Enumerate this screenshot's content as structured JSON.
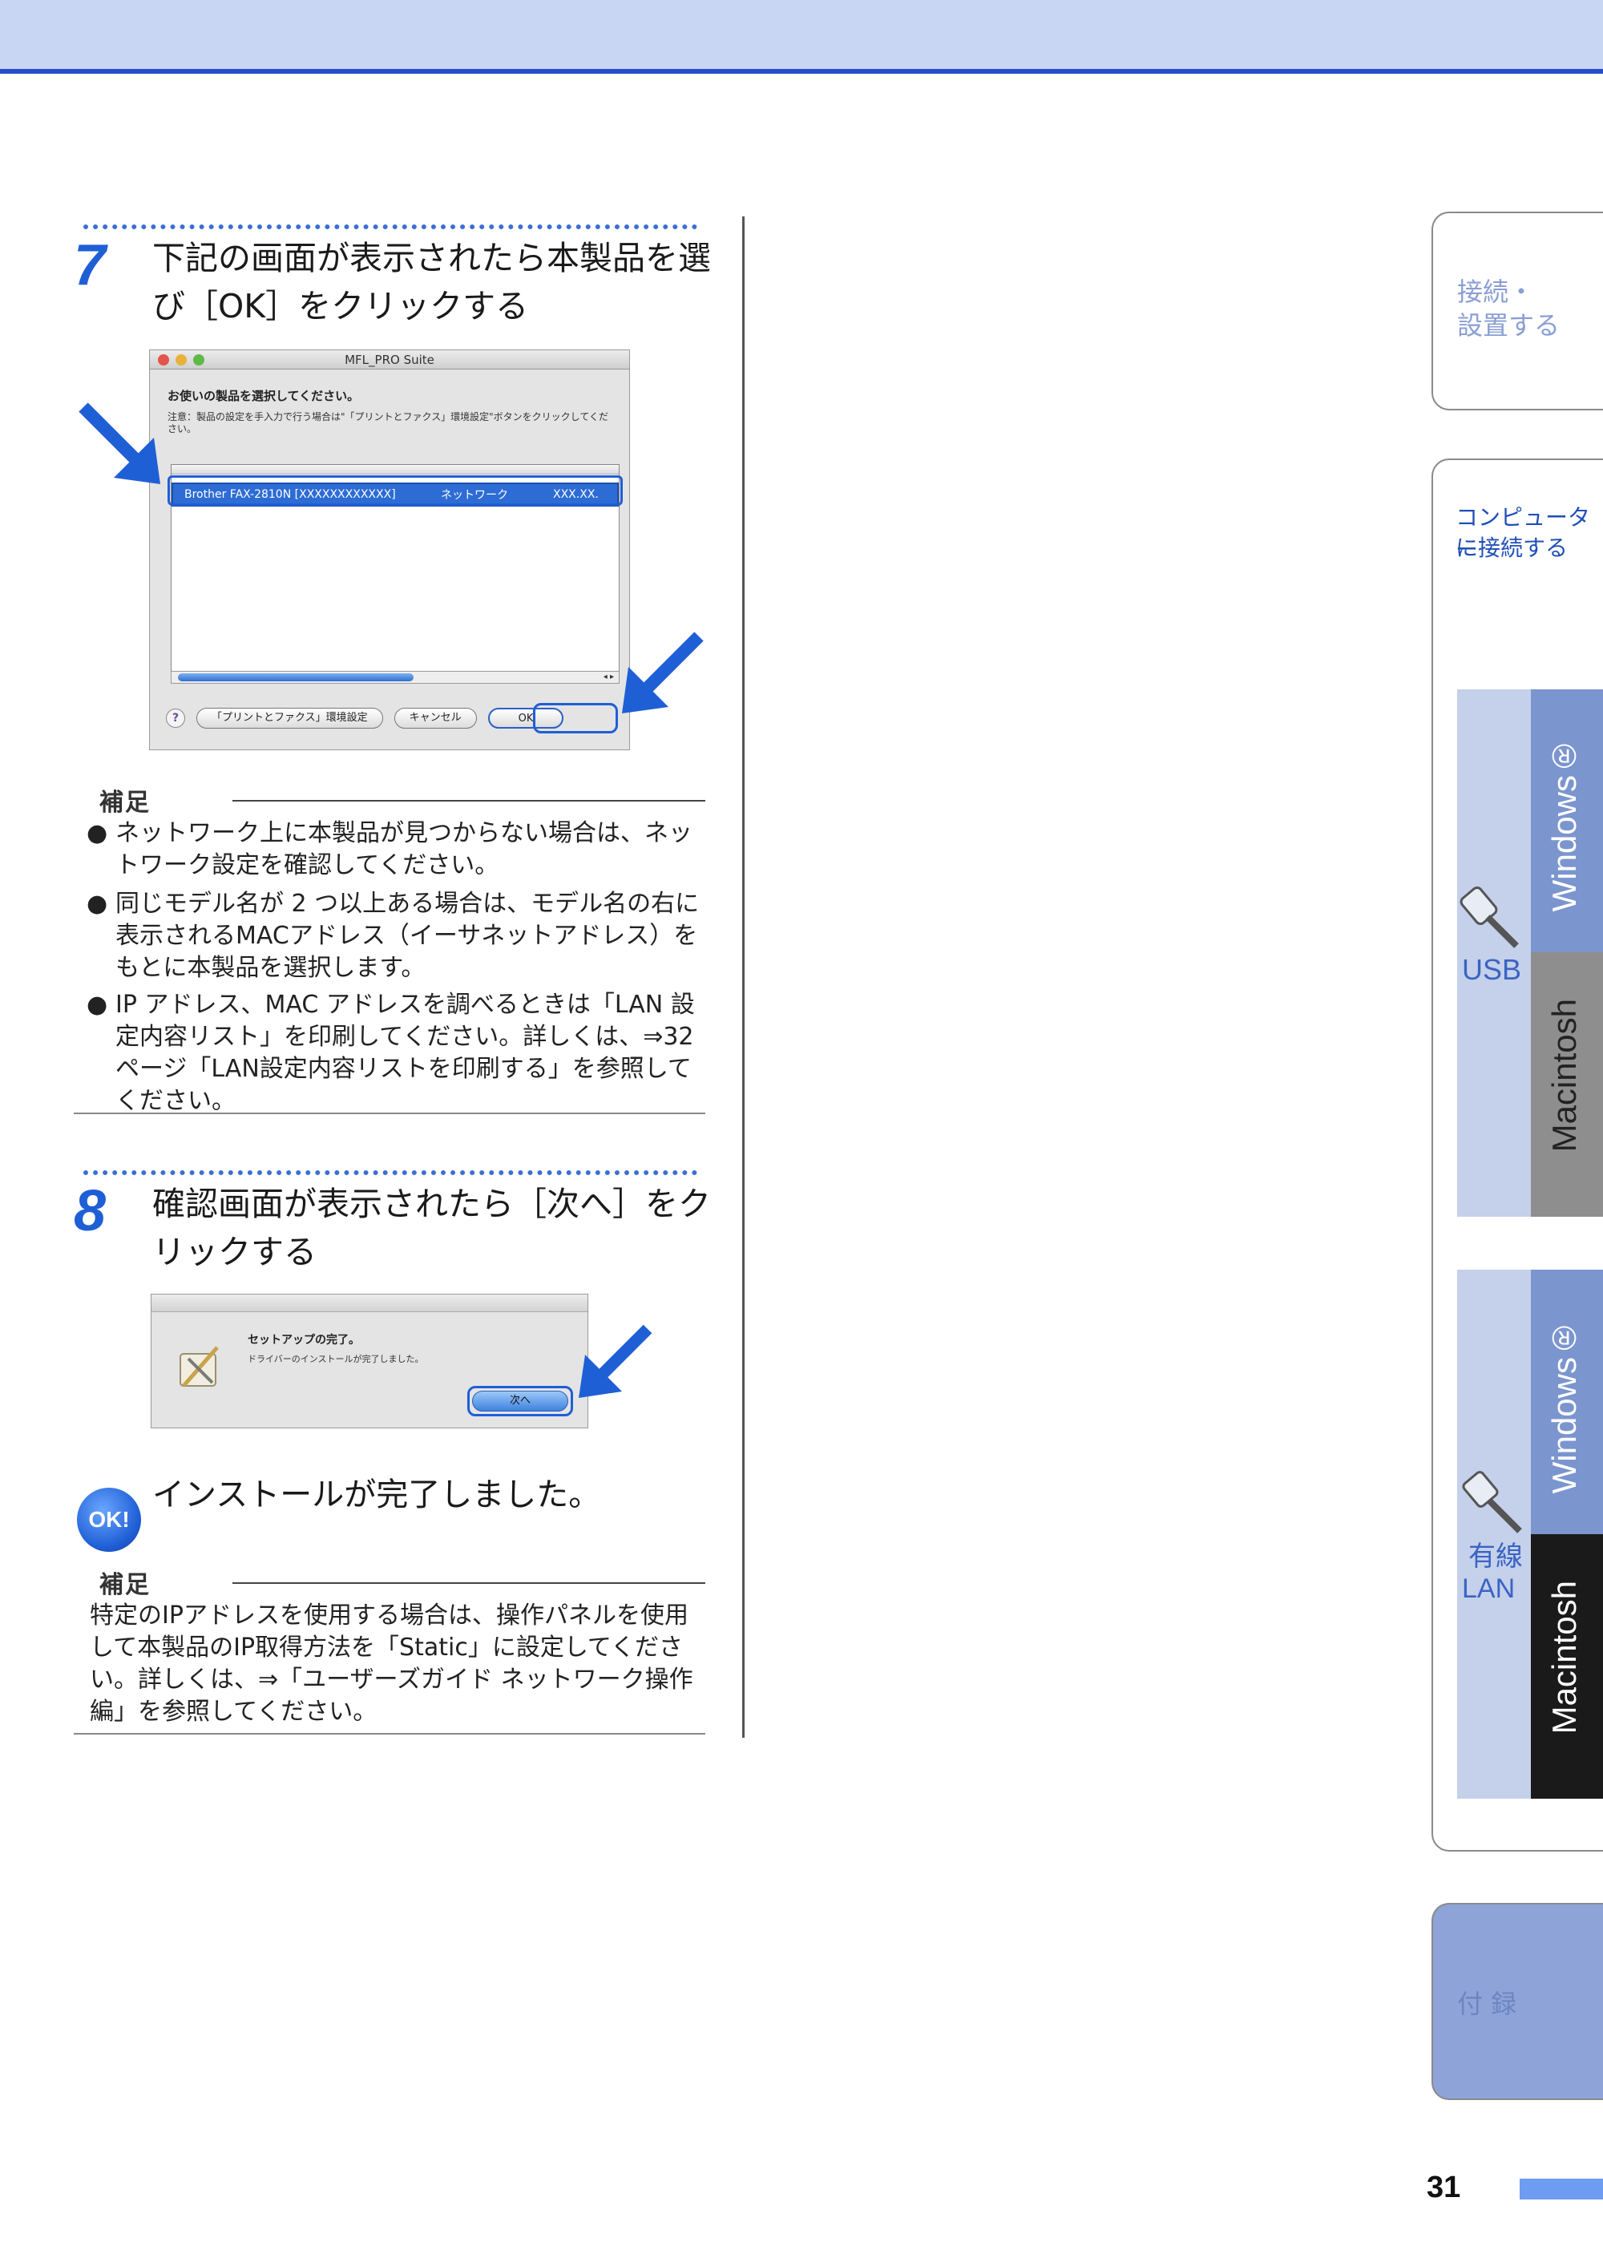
{
  "step7": {
    "number": "7",
    "title_line1": "下記の画面が表示されたら本製品を選",
    "title_line2": "び［OK］をクリックする",
    "dialog": {
      "window_title": "MFL_PRO Suite",
      "heading": "お使いの製品を選択してください。",
      "note": "注意：製品の設定を手入力で行う場合は\"「プリントとファクス」環境設定\"ボタンをクリックしてください。",
      "row": {
        "name": "Brother FAX-2810N [XXXXXXXXXXXX]",
        "type": "ネットワーク",
        "address": "XXX.XX."
      },
      "help_label": "?",
      "print_fax_button": "「プリントとファクス」環境設定",
      "cancel_button": "キャンセル",
      "ok_button": "OK",
      "scroll_buttons": "◂ ▸"
    }
  },
  "hosoku1": {
    "tag": "補足",
    "bullet_mark": "●",
    "items": [
      "ネットワーク上に本製品が見つからない場合は、ネットワーク設定を確認してください。",
      "同じモデル名が 2 つ以上ある場合は、モデル名の右に表示されるMACアドレス（イーサネットアドレス）をもとに本製品を選択します。",
      "IP アドレス、MAC アドレスを調べるときは「LAN 設定内容リスト」を印刷してください。詳しくは、⇒32 ページ「LAN設定内容リストを印刷する」を参照してください。"
    ]
  },
  "step8": {
    "number": "8",
    "title_line1": "確認画面が表示されたら［次へ］をク",
    "title_line2": "リックする",
    "dialog": {
      "heading": "セットアップの完了。",
      "subtext": "ドライバーのインストールが完了しました。",
      "next_button": "次へ"
    }
  },
  "ok_badge": "OK!",
  "done_text": "インストールが完了しました。",
  "hosoku2": {
    "tag": "補足",
    "text": "特定のIPアドレスを使用する場合は、操作パネルを使用して本製品のIP取得方法を「Static」に設定してください。詳しくは、⇒「ユーザーズガイド ネットワーク操作編」を参照してください。"
  },
  "sidebar": {
    "tab1": {
      "line1": "接続・",
      "line2": "設置する"
    },
    "tab2": {
      "line1": "コンピューター",
      "line2": "に接続する"
    },
    "usb": {
      "label": "USB",
      "windows": "Windows®",
      "macintosh": "Macintosh"
    },
    "lan": {
      "line1": "有線",
      "line2": "LAN",
      "windows": "Windows®",
      "macintosh": "Macintosh"
    },
    "tab3": {
      "label": "付 録"
    }
  },
  "page_number": "31",
  "colors": {
    "accent": "#1f5fd6",
    "topbar": "#c9d6f3",
    "tab_blue": "#8ea4d8",
    "tab_light": "#c5d0ea"
  }
}
